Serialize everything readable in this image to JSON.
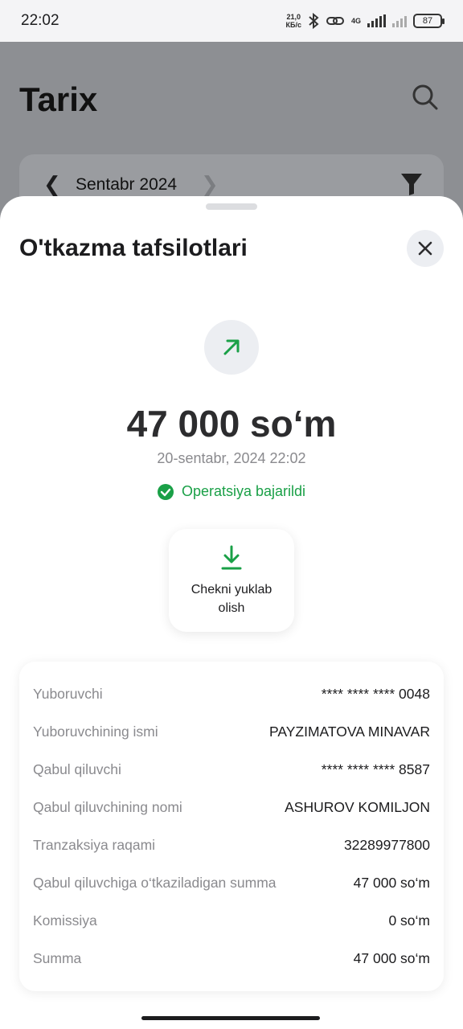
{
  "status_bar": {
    "time": "22:02",
    "net_speed_value": "21,0",
    "net_speed_unit": "КБ/с",
    "network_type": "4G",
    "battery": "87"
  },
  "background_page": {
    "title": "Tarix",
    "month_label": "Sentabr 2024"
  },
  "sheet": {
    "title": "O'tkazma tafsilotlari",
    "amount": "47 000 so‘m",
    "date": "20-sentabr, 2024 22:02",
    "status": "Operatsiya bajarildi",
    "download_label": "Chekni yuklab olish",
    "accent_color": "#1aa047",
    "details": [
      {
        "label": "Yuboruvchi",
        "value": "**** **** **** 0048"
      },
      {
        "label": "Yuboruvchining ismi",
        "value": "PAYZIMATOVA MINAVAR"
      },
      {
        "label": "Qabul qiluvchi",
        "value": "**** **** **** 8587"
      },
      {
        "label": "Qabul qiluvchining nomi",
        "value": "ASHUROV KOMILJON"
      },
      {
        "label": "Tranzaksiya raqami",
        "value": "32289977800"
      },
      {
        "label": "Qabul qiluvchiga o‘tkaziladigan summa",
        "value": "47 000 so‘m"
      },
      {
        "label": "Komissiya",
        "value": "0 so‘m"
      },
      {
        "label": "Summa",
        "value": "47 000 so‘m"
      }
    ]
  },
  "icons": [
    "bluetooth-icon",
    "link-icon",
    "signal-icon",
    "search-icon",
    "filter-icon",
    "close-icon",
    "arrow-up-right-icon",
    "check-circle-icon",
    "download-icon"
  ]
}
